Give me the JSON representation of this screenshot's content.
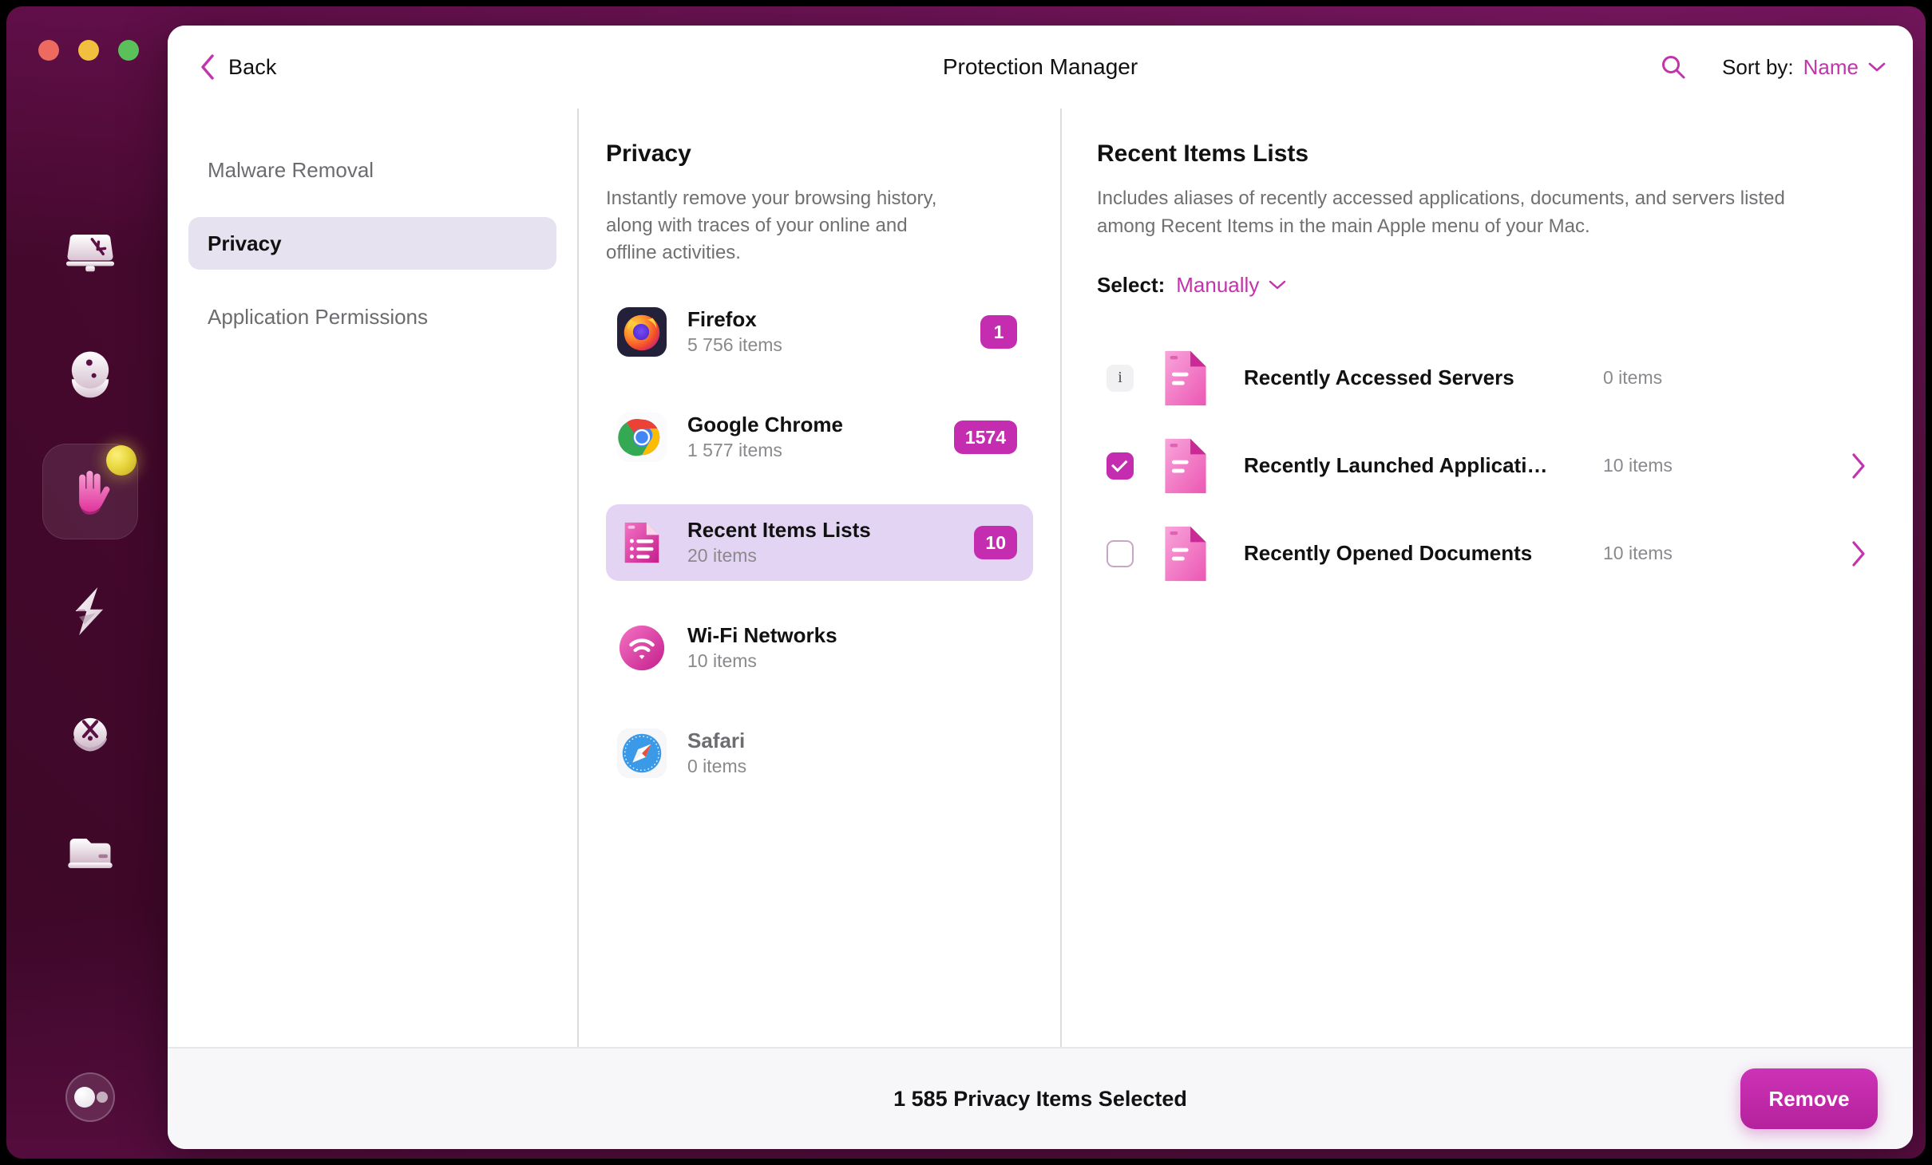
{
  "window": {
    "title": "Protection Manager",
    "back_label": "Back",
    "sort_label": "Sort by:",
    "sort_value": "Name",
    "search_icon": "search-icon",
    "back_icon": "chevron-left-icon",
    "sort_caret_icon": "chevron-down-icon"
  },
  "traffic_lights": {
    "close": "close-window-button",
    "minimize": "minimize-window-button",
    "zoom": "zoom-window-button"
  },
  "dock": {
    "items": [
      {
        "name": "dock-item-system-junk",
        "icon": "imac-icon",
        "active": false,
        "badge": false
      },
      {
        "name": "dock-item-mail-attachments",
        "icon": "sphere-icon",
        "active": false,
        "badge": false
      },
      {
        "name": "dock-item-privacy",
        "icon": "hand-icon",
        "active": true,
        "badge": true
      },
      {
        "name": "dock-item-optimization",
        "icon": "lightning-bolt-icon",
        "active": false,
        "badge": false
      },
      {
        "name": "dock-item-uninstaller",
        "icon": "shield-tool-icon",
        "active": false,
        "badge": false
      },
      {
        "name": "dock-item-shredder",
        "icon": "drive-icon",
        "active": false,
        "badge": false
      }
    ],
    "bottom_item": {
      "name": "dock-item-assistant",
      "icon": "assistant-orb-icon"
    }
  },
  "sidebar": {
    "items": [
      {
        "label": "Malware Removal",
        "selected": false
      },
      {
        "label": "Privacy",
        "selected": true
      },
      {
        "label": "Application Permissions",
        "selected": false
      }
    ]
  },
  "middle": {
    "title": "Privacy",
    "description": "Instantly remove your browsing history, along with traces of your online and offline activities.",
    "apps": [
      {
        "name": "Firefox",
        "count": "5 756 items",
        "badge": "1",
        "icon": "firefox-icon",
        "selected": false,
        "dim": false
      },
      {
        "name": "Google Chrome",
        "count": "1 577 items",
        "badge": "1574",
        "icon": "chrome-icon",
        "selected": false,
        "dim": false
      },
      {
        "name": "Recent Items Lists",
        "count": "20 items",
        "badge": "10",
        "icon": "recent-list-icon",
        "selected": true,
        "dim": false
      },
      {
        "name": "Wi-Fi Networks",
        "count": "10 items",
        "badge": "",
        "icon": "wifi-icon",
        "selected": false,
        "dim": false
      },
      {
        "name": "Safari",
        "count": "0 items",
        "badge": "",
        "icon": "safari-icon",
        "selected": false,
        "dim": true
      }
    ]
  },
  "detail": {
    "title": "Recent Items Lists",
    "description": "Includes aliases of recently accessed applications, documents, and servers listed among Recent Items in the main Apple menu of your Mac.",
    "select_label": "Select:",
    "select_value": "Manually",
    "rows": [
      {
        "name": "Recently Accessed Servers",
        "count": "0 items",
        "control": "info",
        "chevron": false,
        "icon": "document-icon"
      },
      {
        "name": "Recently Launched Applicati…",
        "count": "10 items",
        "control": "checked",
        "chevron": true,
        "icon": "document-icon"
      },
      {
        "name": "Recently Opened Documents",
        "count": "10 items",
        "control": "unchecked",
        "chevron": true,
        "icon": "document-icon"
      }
    ]
  },
  "footer": {
    "status": "1 585 Privacy Items Selected",
    "remove_label": "Remove"
  },
  "colors": {
    "accent": "#c333ac",
    "badge": "#c52db0",
    "selected_row": "#e3d4f3",
    "selected_nav": "#e6e2ef",
    "footer_bg": "#f7f6f9",
    "desktop": "#5a1144"
  }
}
